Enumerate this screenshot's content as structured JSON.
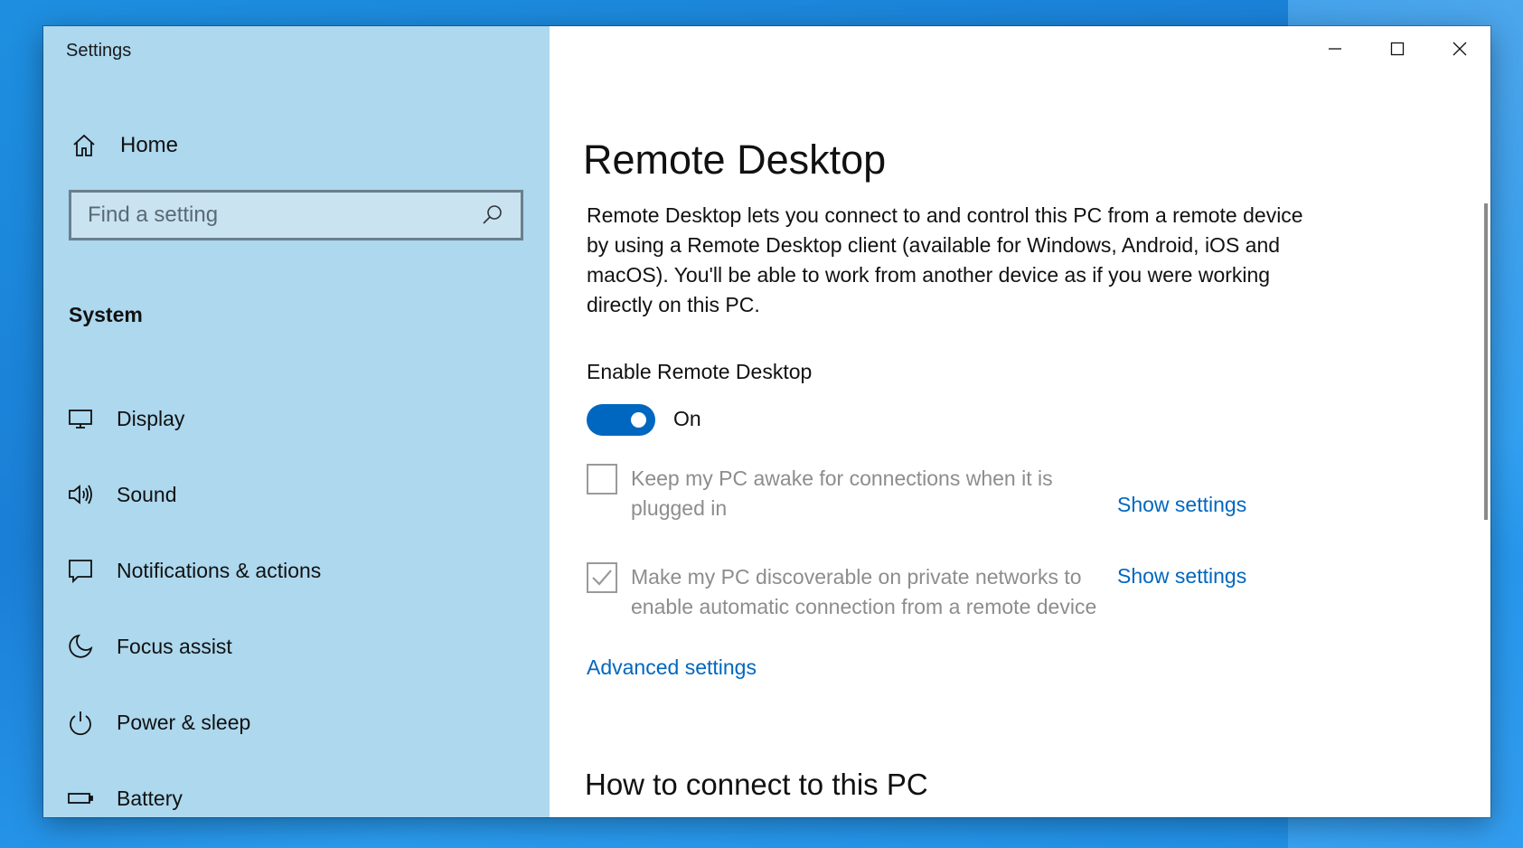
{
  "window": {
    "app_title": "Settings"
  },
  "sidebar": {
    "home_label": "Home",
    "search_placeholder": "Find a setting",
    "group_heading": "System",
    "items": [
      {
        "label": "Display",
        "icon": "monitor-icon"
      },
      {
        "label": "Sound",
        "icon": "speaker-icon"
      },
      {
        "label": "Notifications & actions",
        "icon": "notification-icon"
      },
      {
        "label": "Focus assist",
        "icon": "moon-icon"
      },
      {
        "label": "Power & sleep",
        "icon": "power-icon"
      },
      {
        "label": "Battery",
        "icon": "battery-icon"
      }
    ]
  },
  "main": {
    "title": "Remote Desktop",
    "description": "Remote Desktop lets you connect to and control this PC from a remote device by using a Remote Desktop client (available for Windows, Android, iOS and macOS). You'll be able to work from another device as if you were working directly on this PC.",
    "enable_label": "Enable Remote Desktop",
    "toggle": {
      "on": true,
      "state_label": "On"
    },
    "options": [
      {
        "text": "Keep my PC awake for connections when it is plugged in",
        "checked": false,
        "link": "Show settings"
      },
      {
        "text": "Make my PC discoverable on private networks to enable automatic connection from a remote device",
        "checked": true,
        "link": "Show settings"
      }
    ],
    "advanced_link": "Advanced settings",
    "section_heading": "How to connect to this PC"
  },
  "colors": {
    "accent": "#0067c0",
    "sidebar_bg": "#add8ee",
    "disabled_text": "#8d8d8d"
  }
}
